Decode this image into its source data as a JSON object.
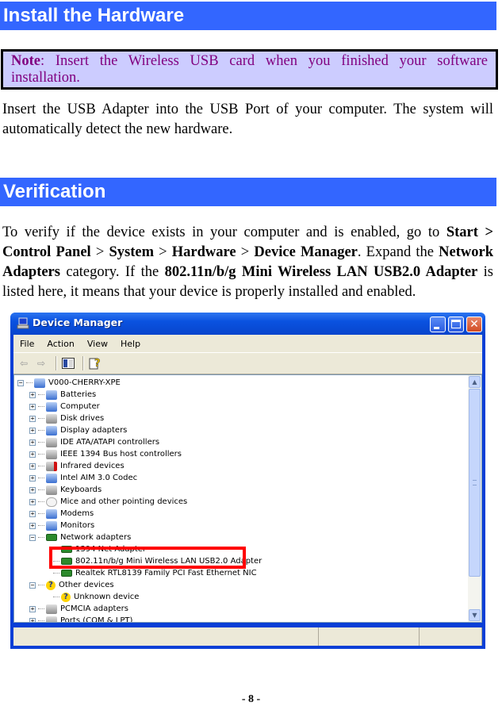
{
  "sections": [
    {
      "heading": "Install the Hardware"
    },
    {
      "heading": "Verification"
    }
  ],
  "note": {
    "label": "Note",
    "text": ": Insert the Wireless USB card when you finished your software installation."
  },
  "install_paragraph": "Insert the USB Adapter into the USB Port of your computer. The system will automatically detect the new hardware.",
  "verify_paragraph": {
    "t1": "To verify if the device exists in your computer and is enabled, go to ",
    "b1": "Start >",
    "b2": "Control Panel",
    "t2": " > ",
    "b3": "System",
    "t3": " > ",
    "b4": "Hardware",
    "t4": " > ",
    "b5": "Device Manager",
    "t5": ". Expand the ",
    "b6": "Network Adapters",
    "t6": " category. If the ",
    "b7": "802.11n/b/g Mini Wireless LAN USB2.0 Adapter",
    "t7": " is listed here, it means that your device is properly installed and enabled."
  },
  "window": {
    "title": "Device Manager",
    "menu": [
      "File",
      "Action",
      "View",
      "Help"
    ],
    "toolbar_icons": [
      "back-arrow-icon",
      "forward-arrow-icon",
      "show-hide-console-tree-icon",
      "help-icon"
    ],
    "close_glyph": "✕",
    "tree": {
      "root": "V000-CHERRY-XPE",
      "items": [
        {
          "label": "Batteries",
          "expander": "+",
          "icon": "battery-icon"
        },
        {
          "label": "Computer",
          "expander": "+",
          "icon": "computer-icon"
        },
        {
          "label": "Disk drives",
          "expander": "+",
          "icon": "disk-drive-icon"
        },
        {
          "label": "Display adapters",
          "expander": "+",
          "icon": "display-adapter-icon"
        },
        {
          "label": "IDE ATA/ATAPI controllers",
          "expander": "+",
          "icon": "ide-controller-icon"
        },
        {
          "label": "IEEE 1394 Bus host controllers",
          "expander": "+",
          "icon": "ieee1394-icon"
        },
        {
          "label": "Infrared devices",
          "expander": "+",
          "icon": "infrared-icon"
        },
        {
          "label": "Intel AIM 3.0 Codec",
          "expander": "+",
          "icon": "codec-icon"
        },
        {
          "label": "Keyboards",
          "expander": "+",
          "icon": "keyboard-icon"
        },
        {
          "label": "Mice and other pointing devices",
          "expander": "+",
          "icon": "mouse-icon"
        },
        {
          "label": "Modems",
          "expander": "+",
          "icon": "modem-icon"
        },
        {
          "label": "Monitors",
          "expander": "+",
          "icon": "monitor-icon"
        },
        {
          "label": "Network adapters",
          "expander": "−",
          "icon": "network-adapter-icon",
          "children": [
            "1394 Net Adapter",
            "802.11n/b/g Mini Wireless LAN USB2.0 Adapter",
            "Realtek RTL8139 Family PCI Fast Ethernet NIC"
          ]
        },
        {
          "label": "Other devices",
          "expander": "−",
          "icon": "unknown-device-icon",
          "children": [
            "Unknown device"
          ]
        },
        {
          "label": "PCMCIA adapters",
          "expander": "+",
          "icon": "pcmcia-icon"
        },
        {
          "label": "Ports (COM & LPT)",
          "expander": "+",
          "icon": "port-icon"
        }
      ]
    },
    "highlighted_item": "802.11n/b/g Mini Wireless LAN USB2.0 Adapter"
  },
  "page_number": "- 8 -",
  "colors": {
    "section_bar": "#3366ff",
    "note_bg": "#ccccff",
    "note_text": "#800080",
    "highlight": "#ff0000"
  }
}
